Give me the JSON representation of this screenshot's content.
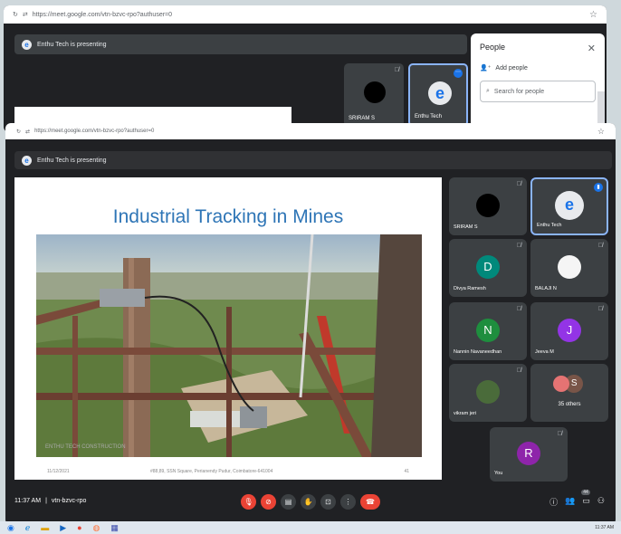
{
  "back_window": {
    "url": "https://meet.google.com/vtn-bzvc-rpo?authuser=0",
    "presenting": "Enthu Tech is presenting",
    "tiles": [
      {
        "name": "SRIRAM S",
        "muted": true
      },
      {
        "name": "Enthu Tech",
        "muted": false,
        "active": true
      }
    ]
  },
  "people_panel": {
    "title": "People",
    "add_label": "Add people",
    "search_placeholder": "Search for people"
  },
  "front_window": {
    "url": "https://meet.google.com/vtn-bzvc-rpo?authuser=0",
    "presenting": "Enthu Tech is presenting"
  },
  "slide": {
    "title": "Industrial Tracking in Mines",
    "photo_caption": "ENTHU TECH\nCONSTRUCTION",
    "footer_date": "11/12/2021",
    "footer_address": "#88,89, SSN Square, Perianendy Pudur, Coimbatore-641004",
    "footer_page": "41"
  },
  "participants": [
    {
      "name": "SRIRAM S",
      "initial": "",
      "muted": true,
      "color": "#000000"
    },
    {
      "name": "Enthu Tech",
      "initial": "e",
      "muted": false,
      "active": true,
      "color": "#e8eaed"
    },
    {
      "name": "Divya Ramesh",
      "initial": "D",
      "muted": true,
      "color": "#00897b"
    },
    {
      "name": "BALAJI N",
      "initial": "",
      "muted": true,
      "color": "#f5f5f5"
    },
    {
      "name": "Nannin Navaneedhan",
      "initial": "N",
      "muted": true,
      "color": "#1e8e3e"
    },
    {
      "name": "Jeeva M",
      "initial": "J",
      "muted": true,
      "color": "#9334e6"
    },
    {
      "name": "vikram jeri",
      "initial": "",
      "muted": true,
      "color": "#4a6b3a"
    },
    {
      "name": "35 others",
      "initial": "S",
      "muted": false,
      "color": "#795548"
    },
    {
      "name": "You",
      "initial": "R",
      "muted": true,
      "color": "#8e24aa"
    }
  ],
  "bottom_bar": {
    "time": "11:37 AM",
    "meeting_code": "vtn-bzvc-rpo",
    "people_count": "44"
  },
  "taskbar": {
    "clock": "11:37 AM"
  }
}
